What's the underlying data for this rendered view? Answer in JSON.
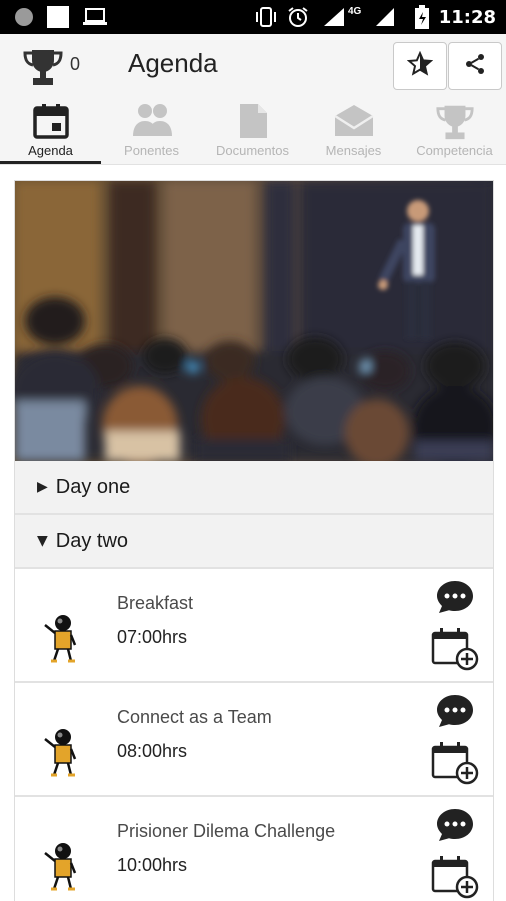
{
  "status_bar": {
    "network": "4G",
    "time": "11:28"
  },
  "app_bar": {
    "trophy_count": "0",
    "title": "Agenda",
    "favorite_icon": "star-icon",
    "share_icon": "share-icon"
  },
  "tabs": [
    {
      "label": "Agenda",
      "icon": "calendar-icon",
      "active": true
    },
    {
      "label": "Ponentes",
      "icon": "people-icon",
      "active": false
    },
    {
      "label": "Documentos",
      "icon": "document-icon",
      "active": false
    },
    {
      "label": "Mensajes",
      "icon": "mail-icon",
      "active": false
    },
    {
      "label": "Competencia",
      "icon": "trophy-icon",
      "active": false
    }
  ],
  "agenda": {
    "days": [
      {
        "label": "Day one",
        "expanded": false
      },
      {
        "label": "Day two",
        "expanded": true
      }
    ],
    "sessions": [
      {
        "title": "Breakfast",
        "time": "07:00hrs"
      },
      {
        "title": "Connect as a Team",
        "time": "08:00hrs"
      },
      {
        "title": "Prisioner Dilema Challenge",
        "time": "10:00hrs"
      }
    ]
  },
  "colors": {
    "active_tab": "#222222",
    "inactive_tab": "#b5b5b5",
    "session_icon": "#e3a42a"
  }
}
